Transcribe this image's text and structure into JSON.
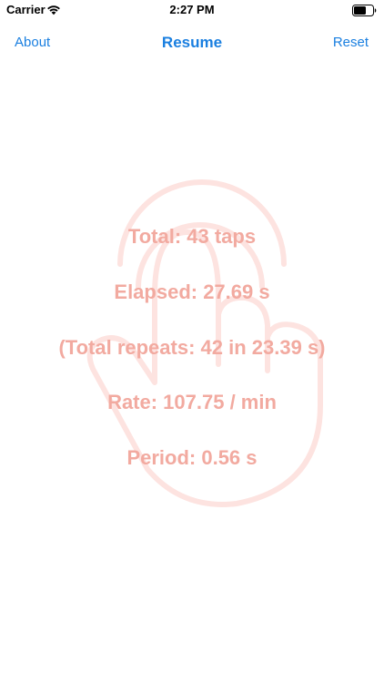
{
  "status_bar": {
    "carrier": "Carrier",
    "time": "2:27 PM",
    "wifi_icon": "wifi-icon",
    "battery_icon": "battery-icon"
  },
  "nav": {
    "left_label": "About",
    "title": "Resume",
    "right_label": "Reset"
  },
  "stats": {
    "total": "Total: 43 taps",
    "elapsed": "Elapsed: 27.69 s",
    "repeats": "(Total repeats: 42 in 23.39 s)",
    "rate": "Rate: 107.75 / min",
    "period": "Period: 0.56 s"
  },
  "background_icon": "tap-hand-icon",
  "colors": {
    "accent": "#1a7fe0",
    "stat_text": "#f2aaa0",
    "watermark": "#fde3e0"
  }
}
